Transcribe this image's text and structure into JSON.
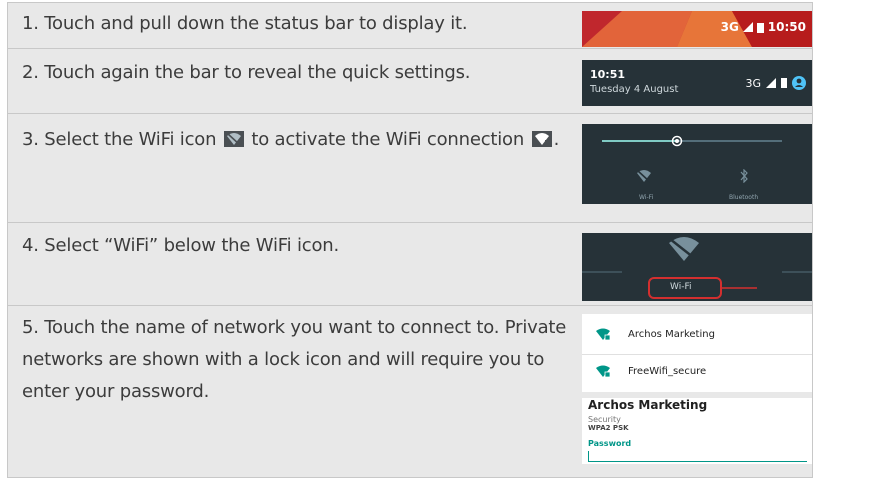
{
  "steps": [
    {
      "text": "1. Touch and pull down the status bar to display it."
    },
    {
      "text": "2. Touch again the bar to reveal the quick settings."
    },
    {
      "text_before": "3. Select the WiFi icon",
      "text_middle": "to activate the WiFi connection",
      "text_after": "."
    },
    {
      "text": "4. Select “WiFi” below the WiFi icon."
    },
    {
      "text": "5. Touch the name of network you want to connect to. Private networks are shown with a lock icon and will require you to enter your password."
    }
  ],
  "shot1": {
    "network": "3G",
    "time": "10:50",
    "bg_color": "#c0272d"
  },
  "shot2": {
    "time": "10:51",
    "date": "Tuesday 4 August",
    "network": "3G"
  },
  "shot3": {
    "brightness_level": 0.42,
    "wifi_label": "Wi-Fi",
    "bluetooth_label": "Bluetooth",
    "accent": "#80cbc4"
  },
  "shot4": {
    "wifi_label": "Wi-Fi",
    "highlight_color": "#d32f2f"
  },
  "shot5": {
    "networks": [
      {
        "name": "Archos Marketing",
        "icon": "wifi-lock-icon"
      },
      {
        "name": "FreeWifi_secure",
        "icon": "wifi-lock-icon"
      }
    ],
    "dialog": {
      "title": "Archos Marketing",
      "security_label": "Security",
      "security_value": "WPA2 PSK",
      "password_label": "Password",
      "password_value": ""
    },
    "accent": "#009688"
  }
}
